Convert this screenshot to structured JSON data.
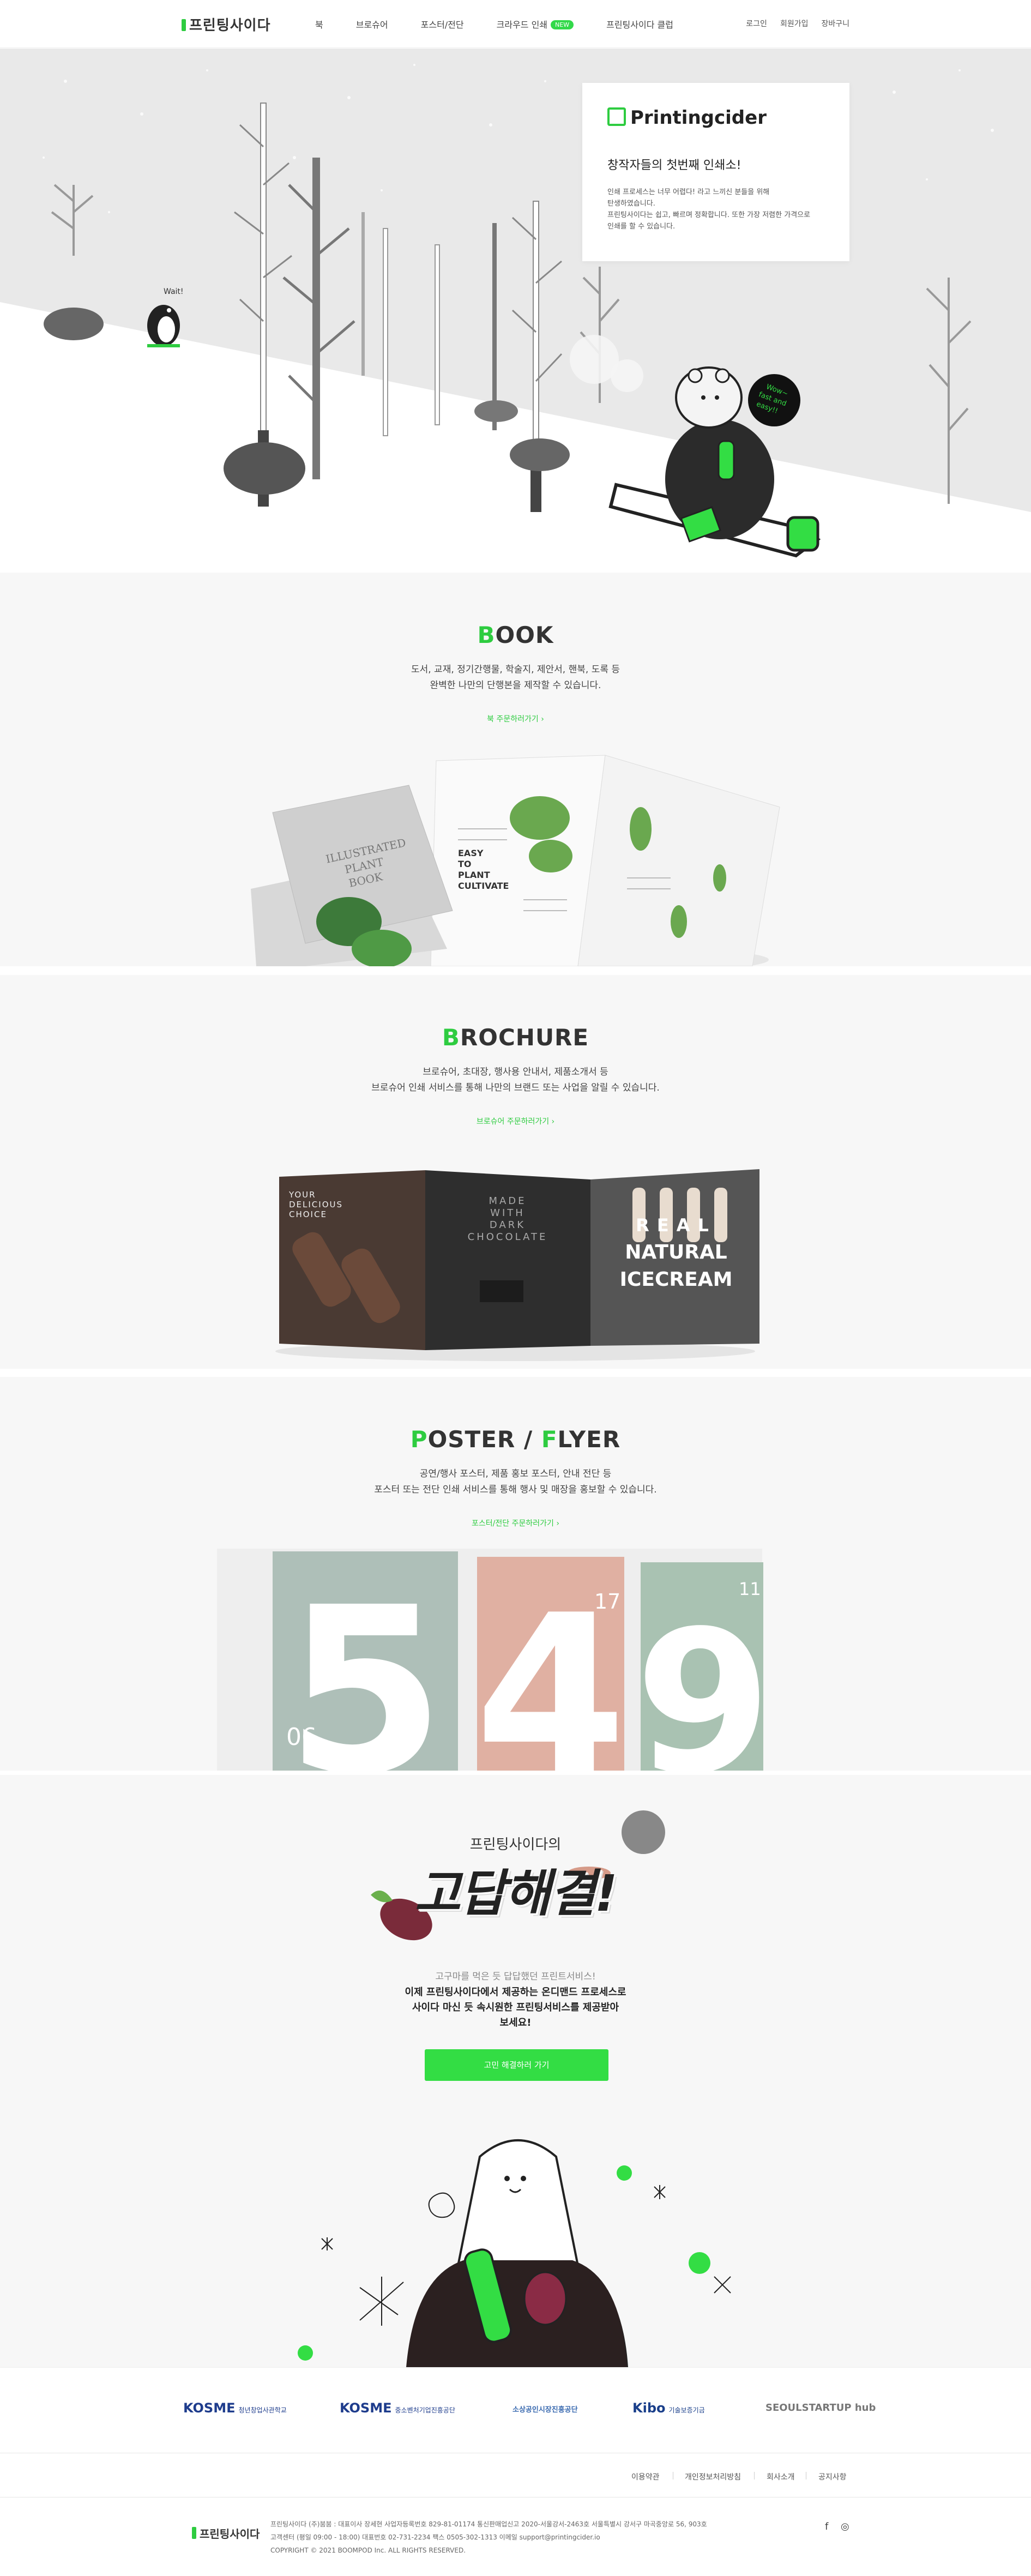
{
  "header": {
    "logo": "프린팅사이다",
    "nav": [
      {
        "label": "북"
      },
      {
        "label": "브로슈어"
      },
      {
        "label": "포스터/전단"
      },
      {
        "label": "크라우드 인쇄",
        "badge": "NEW"
      },
      {
        "label": "프린팅사이다 클럽"
      }
    ],
    "util": [
      "로그인",
      "회원가입",
      "장바구니"
    ]
  },
  "hero": {
    "card_logo": "Printingcider",
    "card_title": "창작자들의 첫번째 인쇄소!",
    "card_desc": [
      "인쇄 프로세스는 너무 어렵다! 라고 느끼신 분들을 위해",
      "탄생하였습니다.",
      "프린팅사이다는 쉽고, 빠르며 정확합니다. 또한 가장 저렴한 가격으로",
      "인쇄를 할 수 있습니다."
    ],
    "penguin_bubble": "Wait!",
    "bear_bubble": [
      "Wow~",
      "fast and",
      "easy!!"
    ]
  },
  "sections": {
    "book": {
      "title_initial": "B",
      "title_rest": "OOK",
      "desc": [
        "도서, 교재, 정기간행물, 학술지, 제안서, 핸북, 도록 등",
        "완벽한 나만의 단행본을 제작할 수 있습니다."
      ],
      "link": "북 주문하러가기  ›",
      "art_title": [
        "ILLUSTRATED",
        "PLANT",
        "BOOK"
      ],
      "art_spread": [
        "EASY",
        "TO",
        "PLANT",
        "CULTIVATE"
      ]
    },
    "brochure": {
      "title_initial": "B",
      "title_rest": "ROCHURE",
      "desc": [
        "브로슈어, 초대장, 행사용 안내서, 제품소개서 등",
        "브로슈어 인쇄 서비스를 통해 나만의 브랜드 또는 사업을 알릴 수 있습니다."
      ],
      "link": "브로슈어 주문하러가기  ›",
      "panel1": [
        "YOUR",
        "DELICIOUS",
        "CHOICE"
      ],
      "panel2": [
        "MADE",
        "WITH",
        "DARK",
        "CHOCOLATE"
      ],
      "panel3": [
        "REAL",
        "NATURAL",
        "ICECREAM"
      ]
    },
    "poster": {
      "title_initial1": "P",
      "title_rest1": "OSTER / ",
      "title_initial2": "F",
      "title_rest2": "LYER",
      "desc": [
        "공연/행사 포스터, 제품 홍보 포스터, 안내 전단 등",
        "포스터 또는 전단 인쇄 서비스를 통해 행사 및 매장을 홍보할 수 있습니다."
      ],
      "link": "포스터/전단 주문하러가기  ›",
      "posters": [
        {
          "digit": "5",
          "small": "06"
        },
        {
          "digit": "4",
          "small": "17"
        },
        {
          "digit": "9",
          "small": "11"
        }
      ]
    }
  },
  "promo": {
    "small": "프린팅사이다의",
    "big": "고답해결!",
    "sub": "고구마를 먹은 듯 답답했던 프린트서비스!",
    "text": [
      "이제 프린팅사이다에서 제공하는 온디맨드 프로세스로",
      "사이다 마신 듯 속시원한 프린팅서비스를 제공받아",
      "보세요!"
    ],
    "button": "고민 해결하러 가기"
  },
  "partners": [
    {
      "name": "KOSME",
      "sub": "청년창업사관학교",
      "color": "#1e3c8c"
    },
    {
      "name": "KOSME",
      "sub": "중소벤처기업진흥공단",
      "color": "#1e3c8c"
    },
    {
      "name": "소상공인시장진흥공단",
      "sub": "",
      "color": "#3a6ab0"
    },
    {
      "name": "Kibo",
      "sub": "기술보증기금",
      "color": "#1a3f8a"
    },
    {
      "name": "SEOULSTARTUP hub",
      "sub": "",
      "color": "#777777"
    }
  ],
  "footer": {
    "links": [
      "이용약관",
      "개인정보처리방침",
      "회사소개",
      "공지사항"
    ],
    "logo": "프린팅사이다",
    "info": [
      "프린팅사이다 (주)붐붐 : 대표이사 장세현   사업자등록번호 829-81-01174   통신판매업신고 2020-서울강서-2463호   서울특별시 강서구 마곡중앙로 56, 903호",
      "고객센터 (평일 09:00 - 18:00)   대표번호 02-731-2234   팩스 0505-302-1313   이메일 support@printingcider.io",
      "COPYRIGHT © 2021 BOOMPOD Inc. ALL RIGHTS RESERVED."
    ],
    "info_label": "고객센터"
  },
  "colors": {
    "accent": "#2ecc40",
    "button": "#33dd44",
    "hero_bg": "#e9e9e9",
    "section_bg": "#f7f7f7"
  }
}
